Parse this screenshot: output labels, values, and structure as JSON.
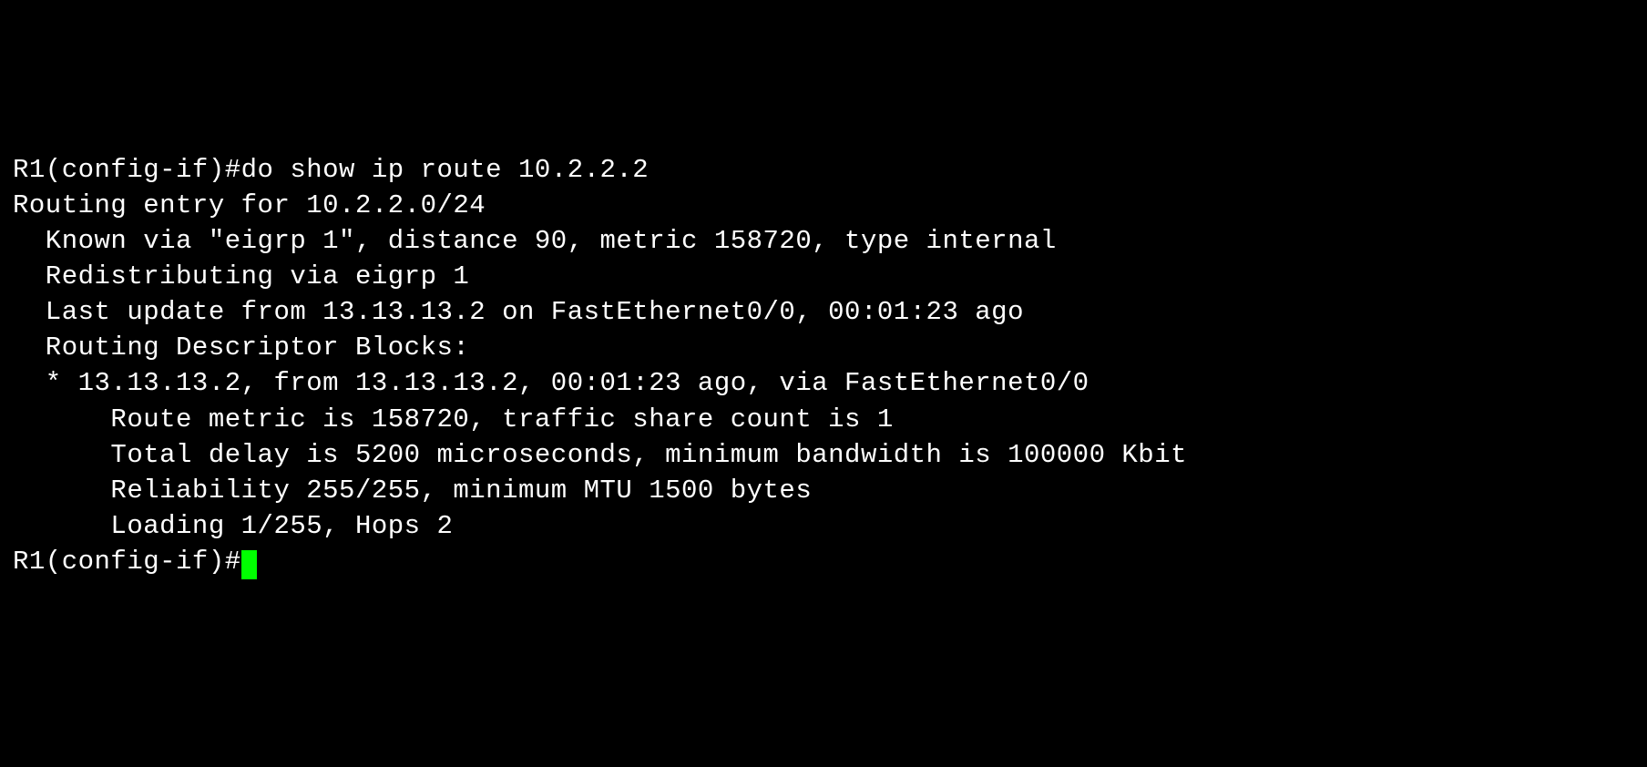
{
  "terminal": {
    "line1_prompt": "R1(config-if)#",
    "line1_command": "do show ip route 10.2.2.2",
    "line2": "Routing entry for 10.2.2.0/24",
    "line3": "  Known via \"eigrp 1\", distance 90, metric 158720, type internal",
    "line4": "  Redistributing via eigrp 1",
    "line5": "  Last update from 13.13.13.2 on FastEthernet0/0, 00:01:23 ago",
    "line6": "  Routing Descriptor Blocks:",
    "line7": "  * 13.13.13.2, from 13.13.13.2, 00:01:23 ago, via FastEthernet0/0",
    "line8": "      Route metric is 158720, traffic share count is 1",
    "line9": "      Total delay is 5200 microseconds, minimum bandwidth is 100000 Kbit",
    "line10": "      Reliability 255/255, minimum MTU 1500 bytes",
    "line11": "      Loading 1/255, Hops 2",
    "line12": "",
    "line13_prompt": "R1(config-if)#"
  }
}
